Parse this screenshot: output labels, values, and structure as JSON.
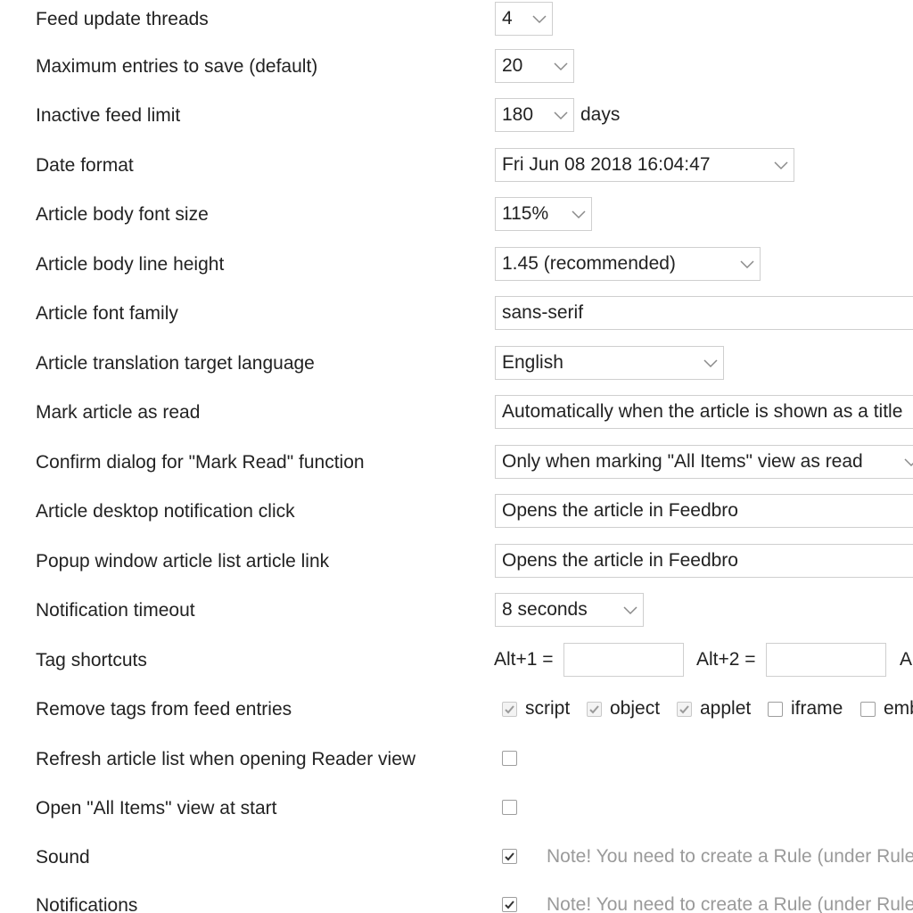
{
  "settings": {
    "feed_update_threads": {
      "label": "Feed update threads",
      "value": "4"
    },
    "max_entries": {
      "label": "Maximum entries to save (default)",
      "value": "20"
    },
    "inactive_feed_limit": {
      "label": "Inactive feed limit",
      "value": "180",
      "suffix": "days"
    },
    "date_format": {
      "label": "Date format",
      "value": "Fri Jun 08 2018 16:04:47"
    },
    "body_font_size": {
      "label": "Article body font size",
      "value": "115%"
    },
    "body_line_height": {
      "label": "Article body line height",
      "value": "1.45 (recommended)"
    },
    "font_family": {
      "label": "Article font family",
      "value": "sans-serif"
    },
    "translation_language": {
      "label": "Article translation target language",
      "value": "English"
    },
    "mark_as_read": {
      "label": "Mark article as read",
      "value": "Automatically when the article is shown as a title"
    },
    "confirm_mark_read": {
      "label": "Confirm dialog for \"Mark Read\" function",
      "value": "Only when marking \"All Items\" view as read"
    },
    "desktop_notification_click": {
      "label": "Article desktop notification click",
      "value": "Opens the article in Feedbro"
    },
    "popup_article_link": {
      "label": "Popup window article list article link",
      "value": "Opens the article in Feedbro"
    },
    "notification_timeout": {
      "label": "Notification timeout",
      "value": "8 seconds"
    },
    "tag_shortcuts": {
      "label": "Tag shortcuts",
      "alt1": "Alt+1 =",
      "alt2": "Alt+2 =",
      "alt3": "A"
    },
    "remove_tags": {
      "label": "Remove tags from feed entries",
      "tags": [
        {
          "name": "script",
          "checked": true
        },
        {
          "name": "object",
          "checked": true
        },
        {
          "name": "applet",
          "checked": true
        },
        {
          "name": "iframe",
          "checked": false
        },
        {
          "name": "emb",
          "checked": false
        }
      ]
    },
    "refresh_reader_view": {
      "label": "Refresh article list when opening Reader view",
      "checked": false
    },
    "open_all_items": {
      "label": "Open \"All Items\" view at start",
      "checked": false
    },
    "sound": {
      "label": "Sound",
      "checked": true,
      "note": "Note! You need to create a Rule (under Rules"
    },
    "notifications": {
      "label": "Notifications",
      "checked": true,
      "note": "Note! You need to create a Rule (under Rules"
    }
  },
  "icons": {
    "dropdown": "chevron-down-icon",
    "check": "checkmark-icon"
  },
  "colors": {
    "border": "#cfcfcf",
    "note_text": "#9a9a9a",
    "label_text": "#222222"
  }
}
